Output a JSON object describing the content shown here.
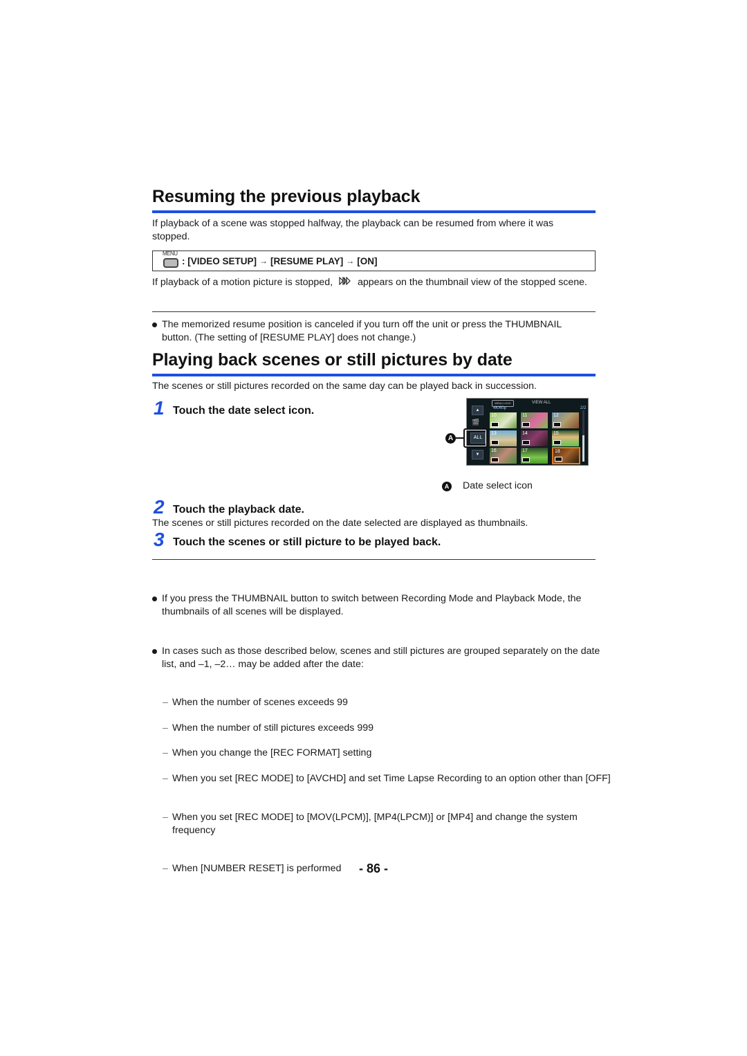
{
  "section1": {
    "title": "Resuming the previous playback",
    "intro": "If playback of a scene was stopped halfway, the playback can be resumed from where it was stopped.",
    "menu_path": {
      "menu_label": "MENU",
      "separator": ":",
      "items": [
        "[VIDEO SETUP]",
        "[RESUME PLAY]",
        "[ON]"
      ],
      "arrow": "→"
    },
    "note_before": "If playback of a motion picture is stopped,",
    "resume_icon": "resume-play-icon",
    "note_after": "appears on the thumbnail view of the stopped scene.",
    "bullets": [
      "The memorized resume position is canceled if you turn off the unit or press the THUMBNAIL button. (The setting of [RESUME PLAY] does not change.)"
    ]
  },
  "section2": {
    "title": "Playing back scenes or still pictures by date",
    "intro": "The scenes or still pictures recorded on the same day can be played back in succession.",
    "steps": [
      {
        "num": "1",
        "text": "Touch the date select icon."
      },
      {
        "num": "2",
        "text": "Touch the playback date.",
        "desc": "The scenes or still pictures recorded on the date selected are displayed as thumbnails."
      },
      {
        "num": "3",
        "text": "Touch the scenes or still picture to be played back."
      }
    ],
    "screen": {
      "top_button": "MENU LOCK",
      "format": "4K/60p",
      "view_label": "VIEW ALL",
      "page": "2/2",
      "all_button": "ALL",
      "thumbnails": [
        {
          "num": "10",
          "badge": "4K"
        },
        {
          "num": "11",
          "badge": "4K"
        },
        {
          "num": "12",
          "badge": "4K"
        },
        {
          "num": "13",
          "badge": "4K"
        },
        {
          "num": "14",
          "badge": "4K"
        },
        {
          "num": "15",
          "badge": "4K"
        },
        {
          "num": "16",
          "badge": "4K"
        },
        {
          "num": "17",
          "badge": "4K"
        },
        {
          "num": "18",
          "badge": "4K"
        }
      ]
    },
    "callout_letter": "A",
    "callout_caption": "Date select icon",
    "bullets": [
      "If you press the THUMBNAIL button to switch between Recording Mode and Playback Mode, the thumbnails of all scenes will be displayed.",
      "In cases such as those described below, scenes and still pictures are grouped separately on the date list, and –1, –2… may be added after the date:"
    ],
    "dash_items": [
      "When the number of scenes exceeds 99",
      "When the number of still pictures exceeds 999",
      "When you change the [REC FORMAT] setting",
      "When you set [REC MODE] to [AVCHD] and set Time Lapse Recording to an option other than [OFF]",
      "When you set [REC MODE] to [MOV(LPCM)], [MP4(LPCM)] or [MP4] and change the system frequency",
      "When [NUMBER RESET] is performed"
    ],
    "dash_mark": "–"
  },
  "footer": {
    "page_number": "- 86 -"
  }
}
